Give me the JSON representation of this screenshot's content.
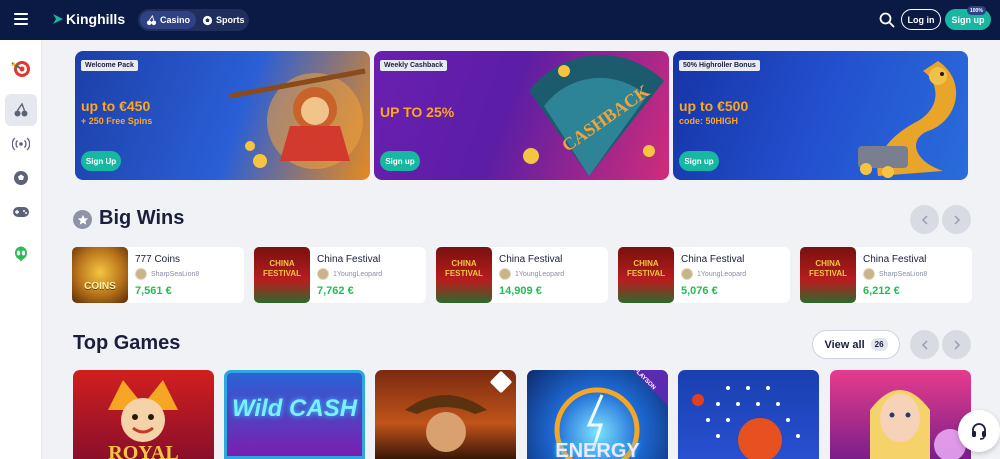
{
  "header": {
    "brand": "Kinghills",
    "modes": [
      {
        "label": "Casino",
        "icon": "cherry-icon",
        "active": true
      },
      {
        "label": "Sports",
        "icon": "soccer-ball-icon",
        "active": false
      }
    ],
    "login_label": "Log in",
    "signup_label": "Sign up",
    "signup_badge": "100%",
    "colors": {
      "bg": "#0b1a44",
      "accent": "#16b8a2"
    }
  },
  "sidebar": {
    "items": [
      {
        "name": "wheel-of-fortune-icon"
      },
      {
        "name": "cherry-icon",
        "active": true
      },
      {
        "name": "live-broadcast-icon"
      },
      {
        "name": "soccer-ball-icon"
      },
      {
        "name": "gamepad-icon"
      },
      {
        "name": "alien-icon"
      }
    ]
  },
  "banners": [
    {
      "tag": "Welcome Pack",
      "headline": "up to €450",
      "sub": "+ 250 Free Spins",
      "cta": "Sign Up"
    },
    {
      "tag": "Weekly Cashback",
      "headline": "UP TO 25%",
      "sub": "",
      "cta": "Sign up",
      "art_text": "CASHBACK"
    },
    {
      "tag": "50% Highroller Bonus",
      "headline": "up to €500",
      "sub": "code: 50HIGH",
      "cta": "Sign up"
    }
  ],
  "big_wins": {
    "title": "Big Wins",
    "items": [
      {
        "game": "777 Coins",
        "user": "SharpSeaLion8",
        "amount": "7,561 €",
        "thumb_text": "COINS"
      },
      {
        "game": "China Festival",
        "user": "1YoungLeopard",
        "amount": "7,762 €",
        "thumb_text": "CHINA FESTIVAL"
      },
      {
        "game": "China Festival",
        "user": "1YoungLeopard",
        "amount": "14,909 €",
        "thumb_text": "CHINA FESTIVAL"
      },
      {
        "game": "China Festival",
        "user": "1YoungLeopard",
        "amount": "5,076 €",
        "thumb_text": "CHINA FESTIVAL"
      },
      {
        "game": "China Festival",
        "user": "SharpSeaLion8",
        "amount": "6,212 €",
        "thumb_text": "CHINA FESTIVAL"
      }
    ]
  },
  "top_games": {
    "title": "Top Games",
    "view_all_label": "View all",
    "count": "26",
    "tiles": [
      {
        "name": "royal-joker-tile",
        "art_text": "ROYAL"
      },
      {
        "name": "wild-cash-tile",
        "art_text": "Wild CASH"
      },
      {
        "name": "book-of-ra-tile",
        "art_text": ""
      },
      {
        "name": "energy-tile",
        "art_text": "ENERGY",
        "provider": "PLAYSON"
      },
      {
        "name": "plinko-tile",
        "art_text": ""
      },
      {
        "name": "lucky-lady-tile",
        "art_text": ""
      }
    ]
  }
}
